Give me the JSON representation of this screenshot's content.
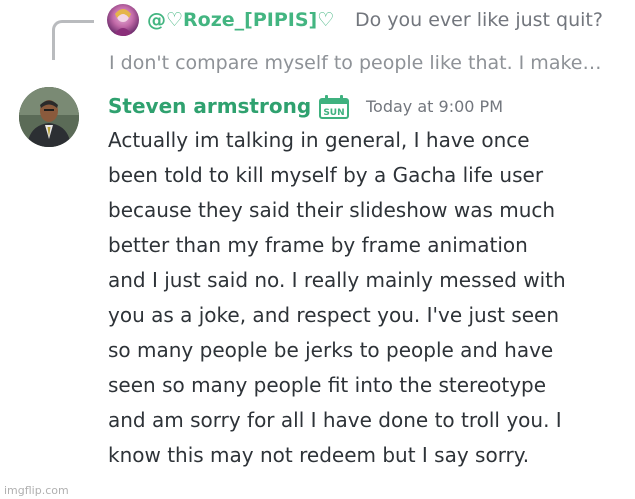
{
  "reply": {
    "author": "@♡Roze_[PIPIS]♡",
    "preview": "Do you ever like just quit?"
  },
  "previous_message": "I don't compare myself to people like that. I make…",
  "message": {
    "author": "Steven armstrong",
    "badge_text": "SUN",
    "badge_icon": "calendar-icon",
    "timestamp": "Today at 9:00 PM",
    "lines": [
      "Actually im talking in general, I have once",
      "been told to kill myself by a Gacha life user",
      "because they said their slideshow was much",
      "better than my frame by frame animation",
      "and I just said no. I really mainly messed with",
      "you as a joke, and respect you. I've just seen",
      "so many people be jerks to people and have",
      "seen so many people fit into the stereotype",
      "and am sorry for all I have done to troll you. I",
      "know this may not redeem but I say sorry."
    ]
  },
  "watermark": "imgflip.com",
  "colors": {
    "author_name": "#2fa16f",
    "reply_name": "#43b581",
    "muted": "#72767d",
    "text": "#2e3338"
  }
}
